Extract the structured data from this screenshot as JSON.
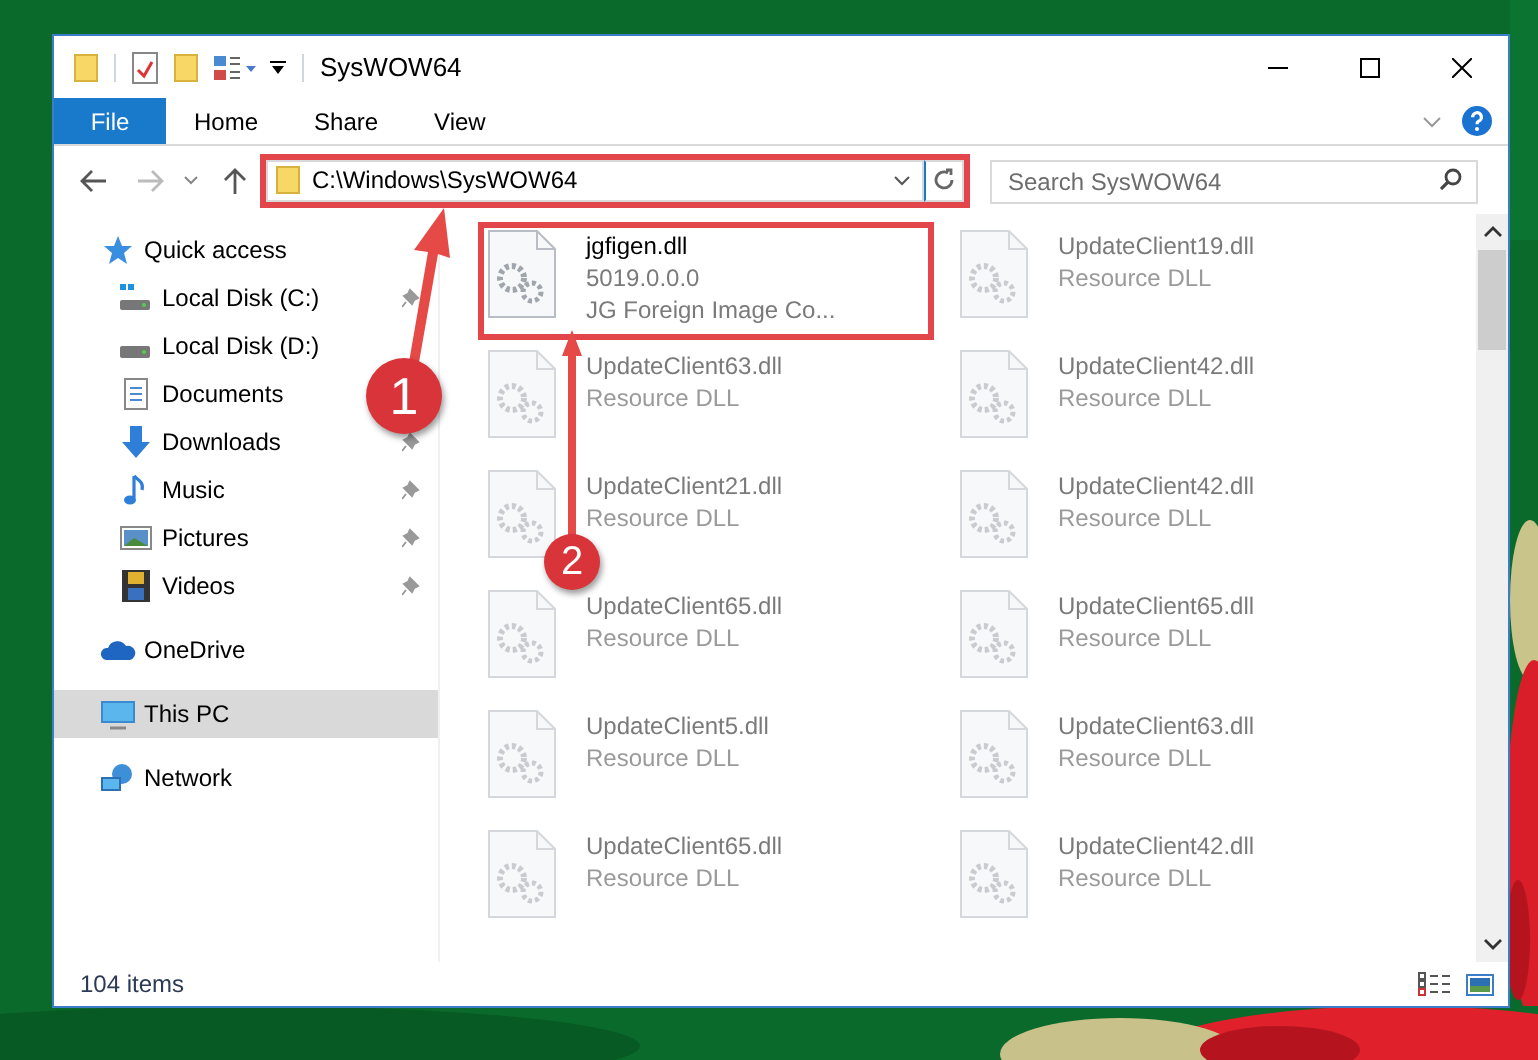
{
  "window": {
    "title": "SysWOW64"
  },
  "ribbon": {
    "file_button": "File",
    "tabs": [
      "Home",
      "Share",
      "View"
    ]
  },
  "address_bar": {
    "path": "C:\\Windows\\SysWOW64",
    "highlighted": true
  },
  "search": {
    "placeholder": "Search SysWOW64"
  },
  "sidebar": {
    "items": [
      {
        "label": "Quick access",
        "kind": "star",
        "selected": false,
        "children": [
          {
            "label": "Local Disk (C:)",
            "kind": "drive-c",
            "pinned": true,
            "selected": false
          },
          {
            "label": "Local Disk (D:)",
            "kind": "drive",
            "pinned": false,
            "selected": false
          },
          {
            "label": "Documents",
            "kind": "documents",
            "pinned": false,
            "selected": false
          },
          {
            "label": "Downloads",
            "kind": "downloads",
            "pinned": true,
            "selected": false
          },
          {
            "label": "Music",
            "kind": "music",
            "pinned": true,
            "selected": false
          },
          {
            "label": "Pictures",
            "kind": "pictures",
            "pinned": true,
            "selected": false
          },
          {
            "label": "Videos",
            "kind": "videos",
            "pinned": true,
            "selected": false
          }
        ]
      },
      {
        "label": "OneDrive",
        "kind": "cloud",
        "selected": false
      },
      {
        "label": "This PC",
        "kind": "pc",
        "selected": true
      },
      {
        "label": "Network",
        "kind": "network",
        "selected": false
      }
    ]
  },
  "files": [
    {
      "name": "jgfigen.dll",
      "details": [
        "5019.0.0.0",
        "JG Foreign Image Co..."
      ],
      "dimmed": false,
      "highlighted": true
    },
    {
      "name": "UpdateClient19.dll",
      "details": [
        "Resource DLL"
      ],
      "dimmed": true,
      "highlighted": false
    },
    {
      "name": "UpdateClient63.dll",
      "details": [
        "Resource DLL"
      ],
      "dimmed": true,
      "highlighted": false
    },
    {
      "name": "UpdateClient42.dll",
      "details": [
        "Resource DLL"
      ],
      "dimmed": true,
      "highlighted": false
    },
    {
      "name": "UpdateClient21.dll",
      "details": [
        "Resource DLL"
      ],
      "dimmed": true,
      "highlighted": false
    },
    {
      "name": "UpdateClient42.dll",
      "details": [
        "Resource DLL"
      ],
      "dimmed": true,
      "highlighted": false
    },
    {
      "name": "UpdateClient65.dll",
      "details": [
        "Resource DLL"
      ],
      "dimmed": true,
      "highlighted": false
    },
    {
      "name": "UpdateClient65.dll",
      "details": [
        "Resource DLL"
      ],
      "dimmed": true,
      "highlighted": false
    },
    {
      "name": "UpdateClient5.dll",
      "details": [
        "Resource DLL"
      ],
      "dimmed": true,
      "highlighted": false
    },
    {
      "name": "UpdateClient63.dll",
      "details": [
        "Resource DLL"
      ],
      "dimmed": true,
      "highlighted": false
    },
    {
      "name": "UpdateClient65.dll",
      "details": [
        "Resource DLL"
      ],
      "dimmed": true,
      "highlighted": false
    },
    {
      "name": "UpdateClient42.dll",
      "details": [
        "Resource DLL"
      ],
      "dimmed": true,
      "highlighted": false
    }
  ],
  "status_bar": {
    "item_count": "104 items"
  },
  "callouts": [
    "1",
    "2"
  ]
}
